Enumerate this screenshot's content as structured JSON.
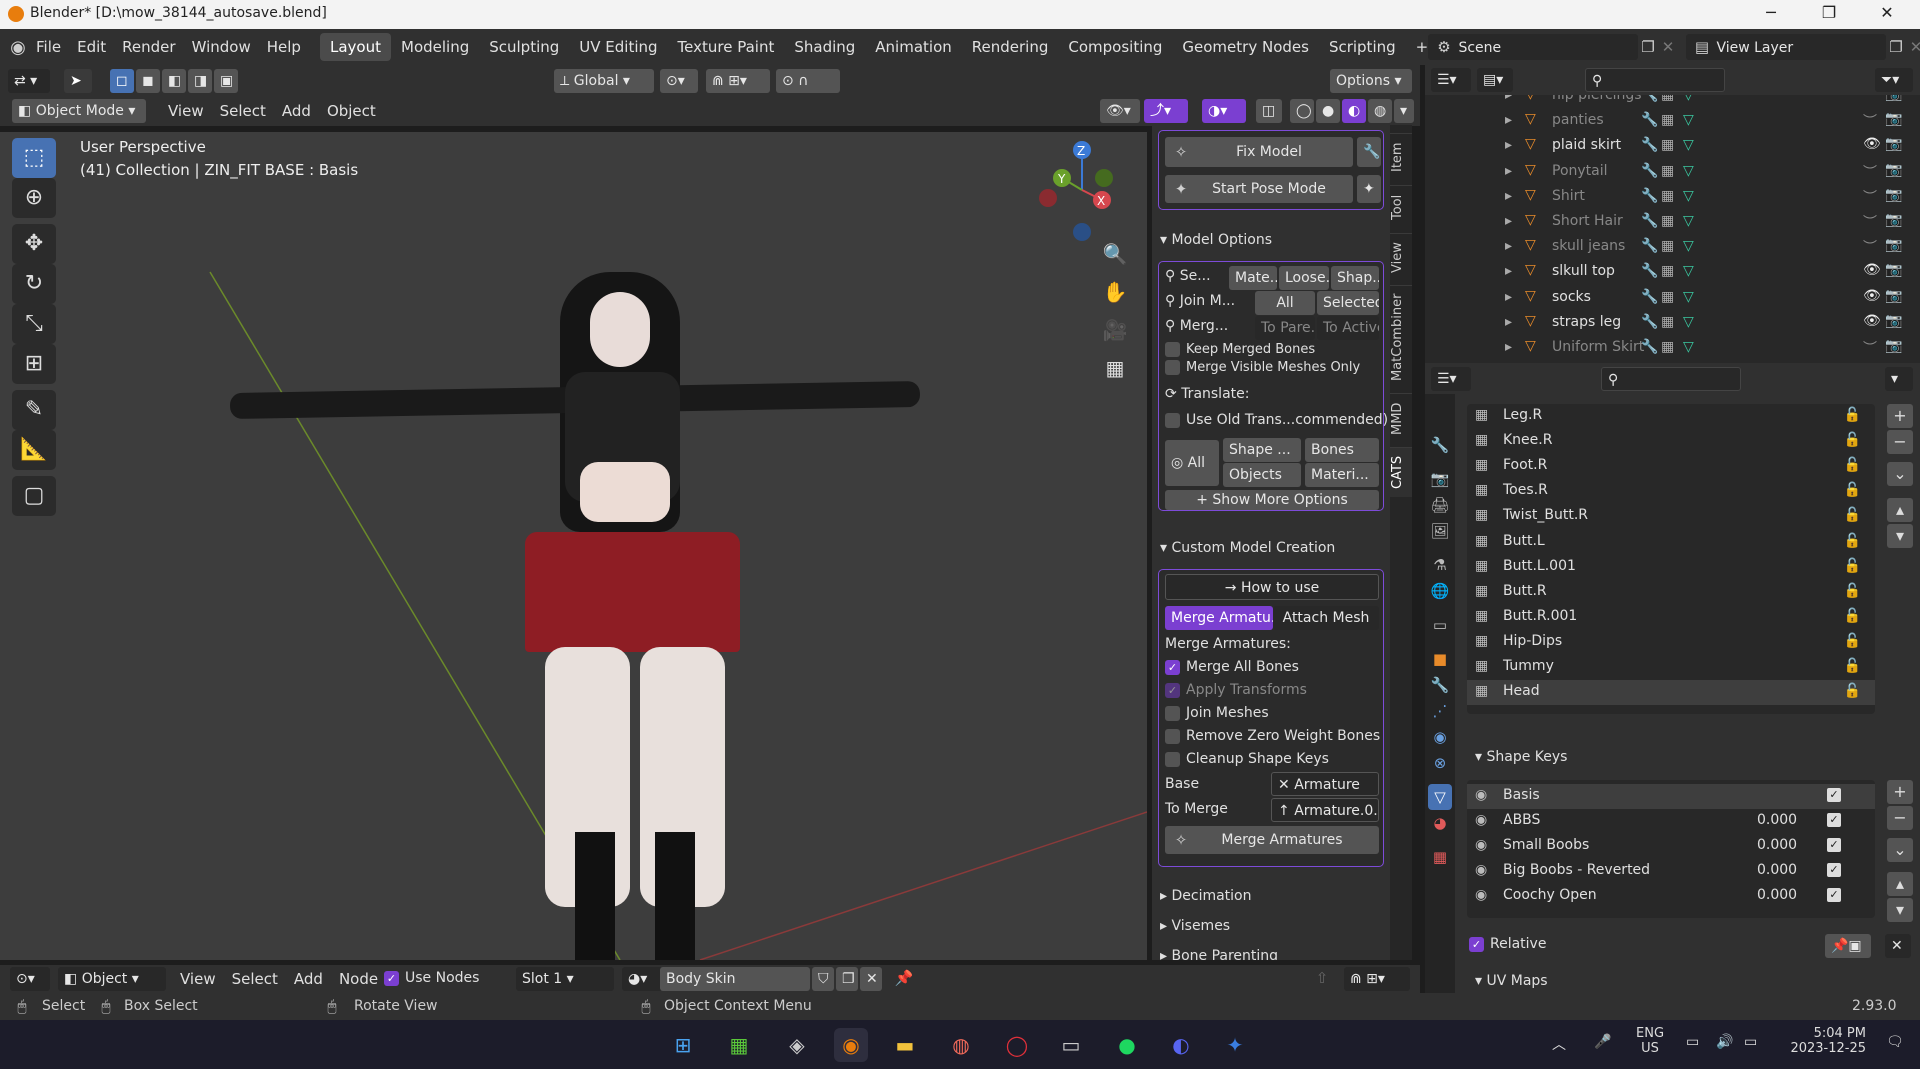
{
  "window": {
    "title": "Blender* [D:\\mow_38144_autosave.blend]"
  },
  "menu": [
    "File",
    "Edit",
    "Render",
    "Window",
    "Help"
  ],
  "workspaces": [
    "Layout",
    "Modeling",
    "Sculpting",
    "UV Editing",
    "Texture Paint",
    "Shading",
    "Animation",
    "Rendering",
    "Compositing",
    "Geometry Nodes",
    "Scripting"
  ],
  "workspace_add": "+",
  "scene": {
    "scene_name": "Scene",
    "view_layer": "View Layer"
  },
  "header": {
    "orientation": "Global",
    "options": "Options",
    "mode": "Object Mode",
    "menus": [
      "View",
      "Select",
      "Add",
      "Object"
    ]
  },
  "viewport": {
    "perspective": "User Perspective",
    "collection": "(41) Collection | ZIN_FIT BASE : Basis",
    "gizmo": {
      "z": "Z",
      "y": "Y",
      "x": "X"
    }
  },
  "npanel": {
    "fix_model": "Fix Model",
    "start_pose": "Start Pose Mode",
    "model_options": "Model Options",
    "sep": "Se...",
    "materials": "Mate...",
    "loose": "Loose...",
    "shape": "Shap...",
    "join": "Join M...",
    "all": "All",
    "selected": "Selected",
    "merge": "Merg...",
    "to_parent": "To Pare...",
    "to_active": "To Active",
    "keep_bones": "Keep Merged Bones",
    "merge_visible": "Merge Visible Meshes Only",
    "translate": "Translate:",
    "use_old": "Use Old Trans...commended)",
    "t_all": "All",
    "t_shape": "Shape ...",
    "t_bones": "Bones",
    "t_objects": "Objects",
    "t_materials": "Materi...",
    "show_more": "Show More Options",
    "custom_creation": "Custom Model Creation",
    "how_to": "How to use",
    "merge_tab": "Merge Armatu...",
    "attach_tab": "Attach Mesh",
    "merge_armatures_lbl": "Merge Armatures:",
    "merge_all_bones": "Merge All Bones",
    "apply_transforms": "Apply Transforms",
    "join_meshes": "Join Meshes",
    "remove_zero": "Remove Zero Weight Bones",
    "cleanup_shape": "Cleanup Shape Keys",
    "base_lbl": "Base",
    "base_val": "Armature",
    "to_merge_lbl": "To Merge",
    "to_merge_val": "Armature.0...",
    "merge_btn": "Merge Armatures",
    "decimation": "Decimation",
    "visemes": "Visemes",
    "bone_parenting": "Bone Parenting"
  },
  "side_tabs": [
    "Item",
    "Tool",
    "View",
    "MatCombiner",
    "MMD",
    "CATS"
  ],
  "outliner": [
    {
      "name": "nip piercings",
      "eye": false
    },
    {
      "name": "panties",
      "eye": false
    },
    {
      "name": "plaid skirt",
      "eye": true
    },
    {
      "name": "Ponytail",
      "eye": false
    },
    {
      "name": "Shirt",
      "eye": false
    },
    {
      "name": "Short Hair",
      "eye": false
    },
    {
      "name": "skull jeans",
      "eye": false
    },
    {
      "name": "slkull top",
      "eye": true
    },
    {
      "name": "socks",
      "eye": true
    },
    {
      "name": "straps leg",
      "eye": true
    },
    {
      "name": "Uniform Skirt",
      "eye": false
    }
  ],
  "vertex_groups": [
    "Leg.R",
    "Knee.R",
    "Foot.R",
    "Toes.R",
    "Twist_Butt.R",
    "Butt.L",
    "Butt.L.001",
    "Butt.R",
    "Butt.R.001",
    "Hip-Dips",
    "Tummy",
    "Head"
  ],
  "shape_keys": {
    "title": "Shape Keys",
    "items": [
      {
        "name": "Basis",
        "value": ""
      },
      {
        "name": "ABBS",
        "value": "0.000"
      },
      {
        "name": "Small Boobs",
        "value": "0.000"
      },
      {
        "name": "Big Boobs - Reverted",
        "value": "0.000"
      },
      {
        "name": "Coochy Open",
        "value": "0.000"
      }
    ],
    "relative": "Relative",
    "uv_maps": "UV Maps"
  },
  "node_header": {
    "type": "Object",
    "menus": [
      "View",
      "Select",
      "Add",
      "Node"
    ],
    "use_nodes": "Use Nodes",
    "slot": "Slot 1",
    "material": "Body Skin"
  },
  "statusbar": {
    "select": "Select",
    "box_select": "Box Select",
    "rotate": "Rotate View",
    "context": "Object Context Menu",
    "version": "2.93.0"
  },
  "taskbar": {
    "lang": "ENG",
    "region": "US",
    "time": "5:04 PM",
    "date": "2023-12-25"
  }
}
